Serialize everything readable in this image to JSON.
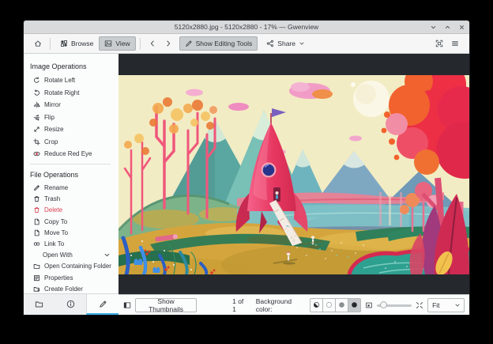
{
  "window": {
    "title": "5120x2880.jpg - 5120x2880 - 17% — Gwenview"
  },
  "toolbar": {
    "browse": "Browse",
    "view": "View",
    "show_editing_tools": "Show Editing Tools",
    "share": "Share"
  },
  "sidebar": {
    "sections": [
      {
        "title": "Image Operations",
        "items": [
          {
            "label": "Rotate Left",
            "icon": "rotate-left-icon"
          },
          {
            "label": "Rotate Right",
            "icon": "rotate-right-icon"
          },
          {
            "label": "Mirror",
            "icon": "mirror-icon"
          },
          {
            "label": "Flip",
            "icon": "flip-icon"
          },
          {
            "label": "Resize",
            "icon": "resize-icon"
          },
          {
            "label": "Crop",
            "icon": "crop-icon"
          },
          {
            "label": "Reduce Red Eye",
            "icon": "red-eye-icon"
          }
        ]
      },
      {
        "title": "File Operations",
        "items": [
          {
            "label": "Rename",
            "icon": "rename-icon"
          },
          {
            "label": "Trash",
            "icon": "trash-icon"
          },
          {
            "label": "Delete",
            "icon": "delete-icon"
          },
          {
            "label": "Copy To",
            "icon": "copy-icon"
          },
          {
            "label": "Move To",
            "icon": "move-icon"
          },
          {
            "label": "Link To",
            "icon": "link-icon"
          },
          {
            "label": "Open With",
            "icon": "chevron-down-icon"
          },
          {
            "label": "Open Containing Folder",
            "icon": "folder-icon"
          },
          {
            "label": "Properties",
            "icon": "properties-icon"
          },
          {
            "label": "Create Folder",
            "icon": "create-folder-icon"
          }
        ]
      }
    ]
  },
  "statusbar": {
    "show_thumbnails": "Show Thumbnails",
    "counter": "1 of 1",
    "background_color_label": "Background color:",
    "zoom_mode": "Fit"
  },
  "colors": {
    "accent": "#3daee9",
    "delete": "#da4453",
    "viewer_background": "#25292d"
  }
}
